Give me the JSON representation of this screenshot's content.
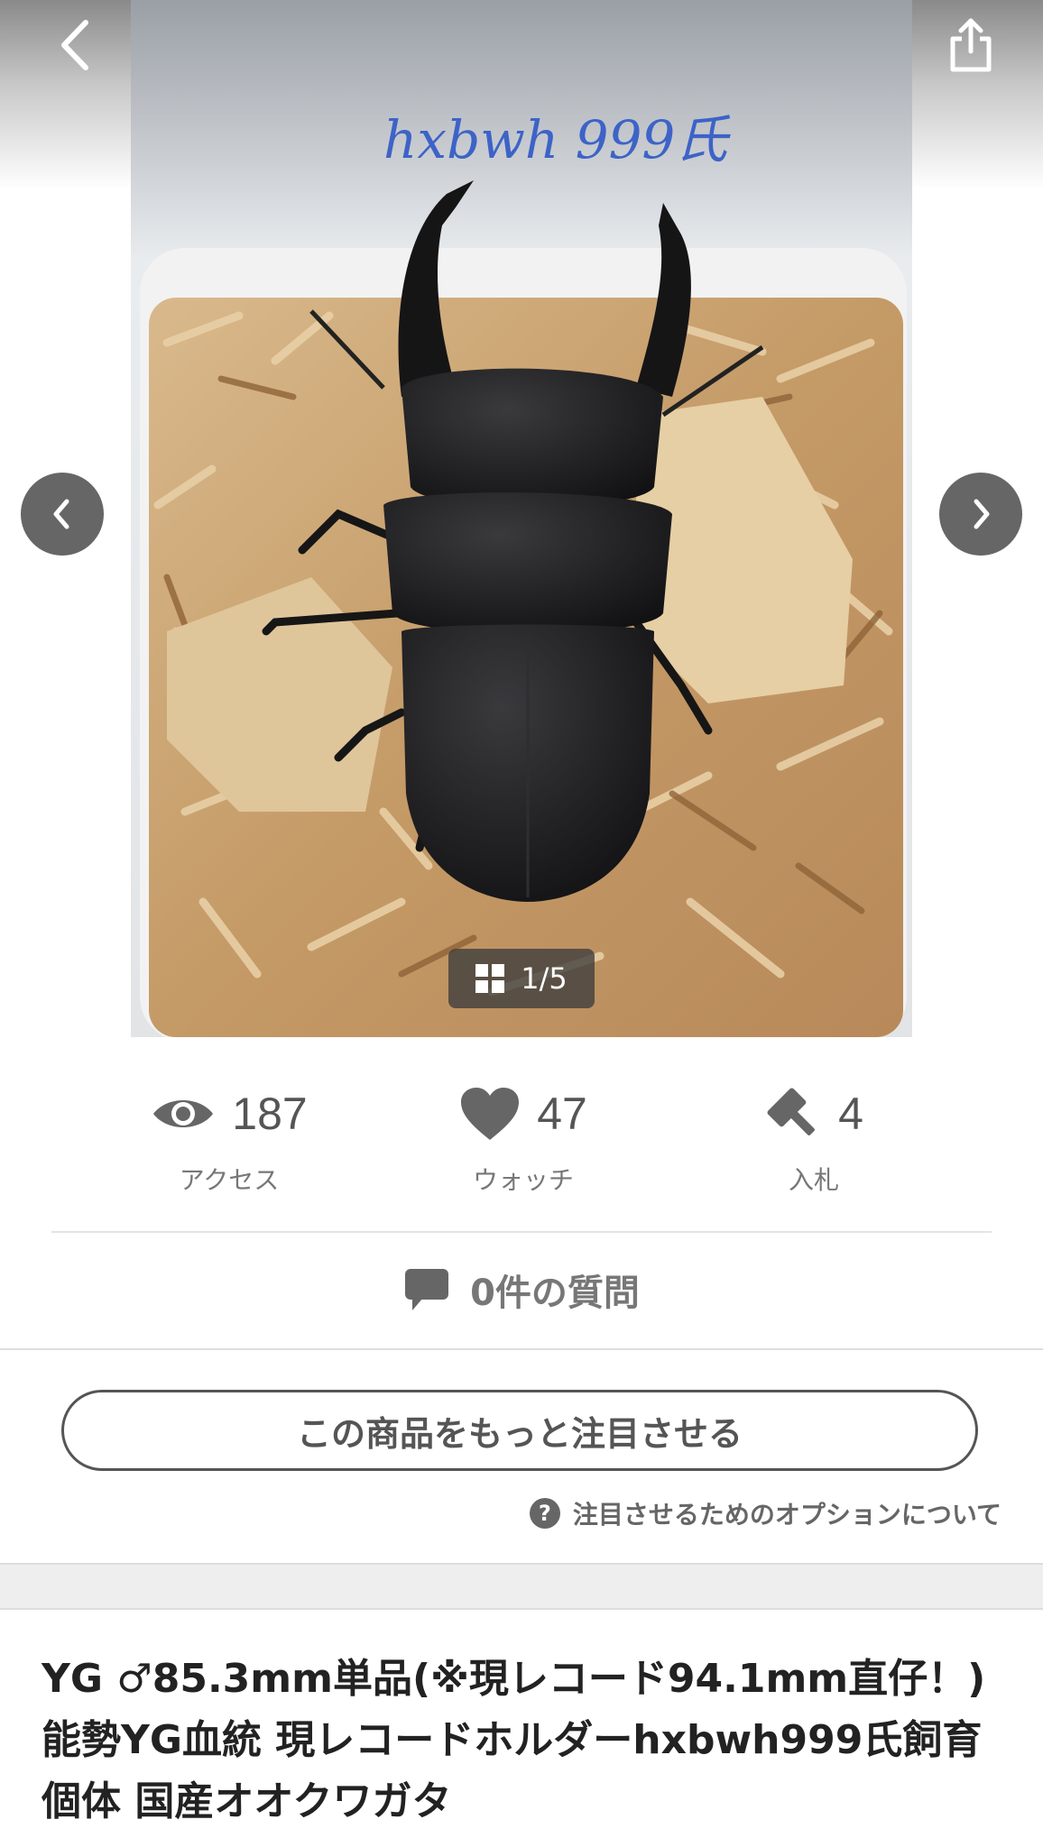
{
  "gallery": {
    "photo_caption": "hxbwh 999氏",
    "counter": "1/5",
    "icons": {
      "back": "chevron-left-icon",
      "share": "share-icon",
      "prev": "chevron-left-icon",
      "next": "chevron-right-icon",
      "grid": "grid-icon"
    }
  },
  "stats": {
    "access": {
      "value": "187",
      "label": "アクセス",
      "icon": "eye-icon"
    },
    "watch": {
      "value": "47",
      "label": "ウォッチ",
      "icon": "heart-icon"
    },
    "bids": {
      "value": "4",
      "label": "入札",
      "icon": "gavel-icon"
    }
  },
  "questions": {
    "label": "0件の質問",
    "icon": "speech-bubble-icon"
  },
  "promote": {
    "button_label": "この商品をもっと注目させる",
    "help_label": "注目させるためのオプションについて",
    "help_icon": "question-circle-icon"
  },
  "item": {
    "title": "YG ♂85.3mm単品(※現レコード94.1mm直仔！) 能勢YG血統 現レコードホルダーhxbwh999氏飼育個体 国産オオクワガタ"
  },
  "colors": {
    "icon_gray": "#666666",
    "text_gray": "#777777",
    "title": "#222222"
  }
}
